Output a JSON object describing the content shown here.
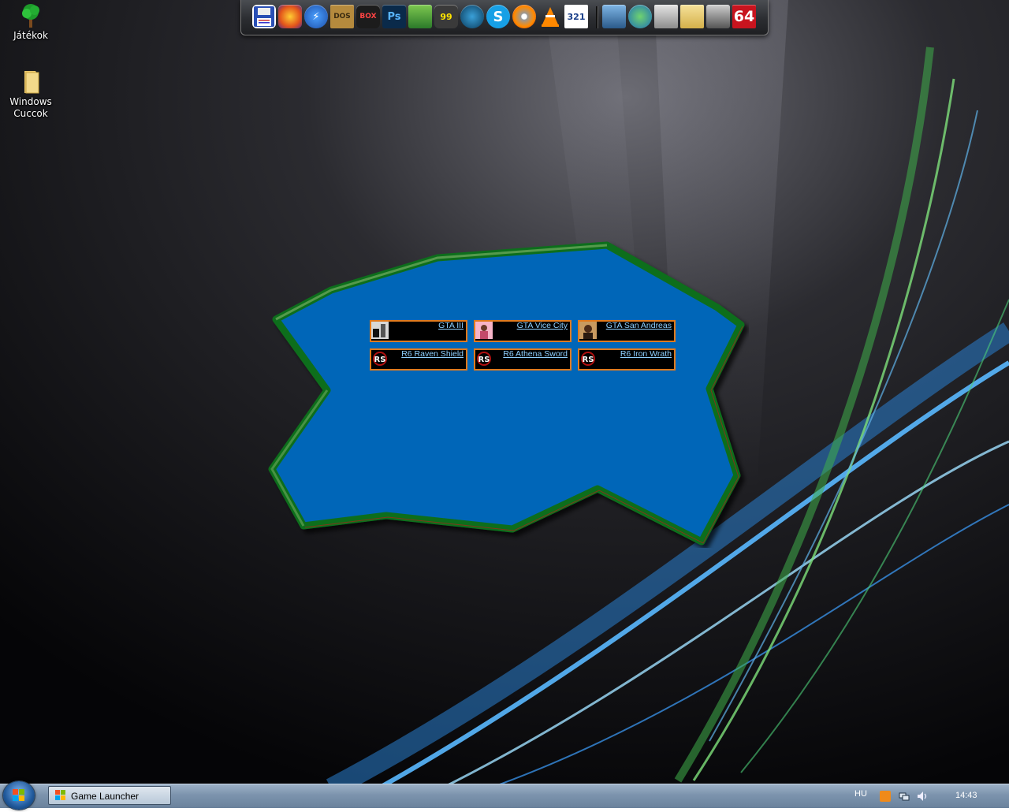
{
  "desktop": {
    "icons": [
      {
        "label": "Játékok"
      },
      {
        "label": "Windows Cuccok"
      }
    ]
  },
  "dock": {
    "icons": [
      "floppy-save-icon",
      "firefox-icon",
      "lightning-icon",
      "dosbox-icon",
      "dbox-icon",
      "photoshop-icon",
      "image-viewer-icon",
      "monitor-99-icon",
      "tv-icon",
      "skype-icon",
      "cd-burn-icon",
      "vlc-icon",
      "calendar-321-icon",
      "network-icon",
      "globe-network-icon",
      "recycle-bin-icon",
      "folder-icon",
      "hardware-icon",
      "c64-icon"
    ],
    "photoshop_text": "Ps",
    "badge_99": "99",
    "badge_321": "321",
    "badge_64": "64"
  },
  "launcher": {
    "games": [
      {
        "title": "GTA III"
      },
      {
        "title": "GTA Vice City"
      },
      {
        "title": "GTA San Andreas"
      },
      {
        "title": "R6 Raven Shield"
      },
      {
        "title": "R6 Athena Sword"
      },
      {
        "title": "R6 Iron Wrath"
      }
    ],
    "rs_badge": "RS",
    "colors": {
      "fill": "#0066b8",
      "border": "#0f6e1a",
      "tile_border": "#e07a1e",
      "link": "#8fd0ff"
    }
  },
  "taskbar": {
    "task_label": "Game Launcher",
    "language": "HU",
    "clock": "14:43"
  }
}
